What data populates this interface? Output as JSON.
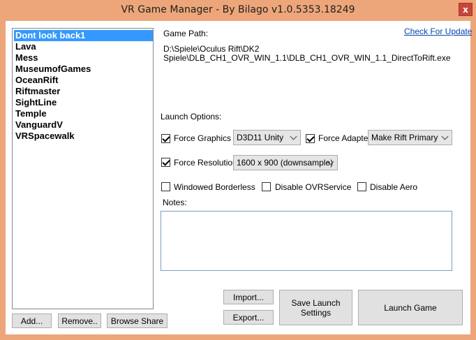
{
  "window": {
    "title": "VR Game Manager - By Bilago v1.0.5353.18249",
    "close_label": "x"
  },
  "games": [
    {
      "label": "Dont look back1",
      "selected": true
    },
    {
      "label": "Lava"
    },
    {
      "label": "Mess"
    },
    {
      "label": "MuseumofGames"
    },
    {
      "label": "OceanRift"
    },
    {
      "label": "Riftmaster"
    },
    {
      "label": "SightLine"
    },
    {
      "label": "Temple"
    },
    {
      "label": "VanguardV"
    },
    {
      "label": "VRSpacewalk"
    }
  ],
  "list_buttons": {
    "add": "Add...",
    "remove": "Remove..",
    "browse": "Browse Share"
  },
  "details": {
    "game_path_label": "Game Path:",
    "check_update": "Check For Update",
    "path_line1": "D:\\Spiele\\Oculus Rift\\DK2",
    "path_line2": "Spiele\\DLB_CH1_OVR_WIN_1.1\\DLB_CH1_OVR_WIN_1.1_DirectToRift.exe",
    "launch_options_label": "Launch Options:",
    "notes_label": "Notes:"
  },
  "options": {
    "force_graphics": {
      "label": "Force Graphics",
      "checked": true,
      "value": "D3D11 Unity"
    },
    "force_adapter": {
      "label": "Force Adapter",
      "checked": true,
      "value": "Make Rift Primary"
    },
    "force_resolution": {
      "label": "Force Resolution",
      "checked": true,
      "value": "1600 x 900 (downsample)"
    },
    "windowed_borderless": {
      "label": "Windowed Borderless",
      "checked": false
    },
    "disable_ovrservice": {
      "label": "Disable OVRService",
      "checked": false
    },
    "disable_aero": {
      "label": "Disable Aero",
      "checked": false
    }
  },
  "action_buttons": {
    "import": "Import...",
    "export": "Export...",
    "save_line1": "Save Launch",
    "save_line2": "Settings",
    "launch": "Launch Game"
  },
  "colors": {
    "frame": "#eda67a",
    "selection": "#3399ff",
    "close": "#c7463a"
  }
}
